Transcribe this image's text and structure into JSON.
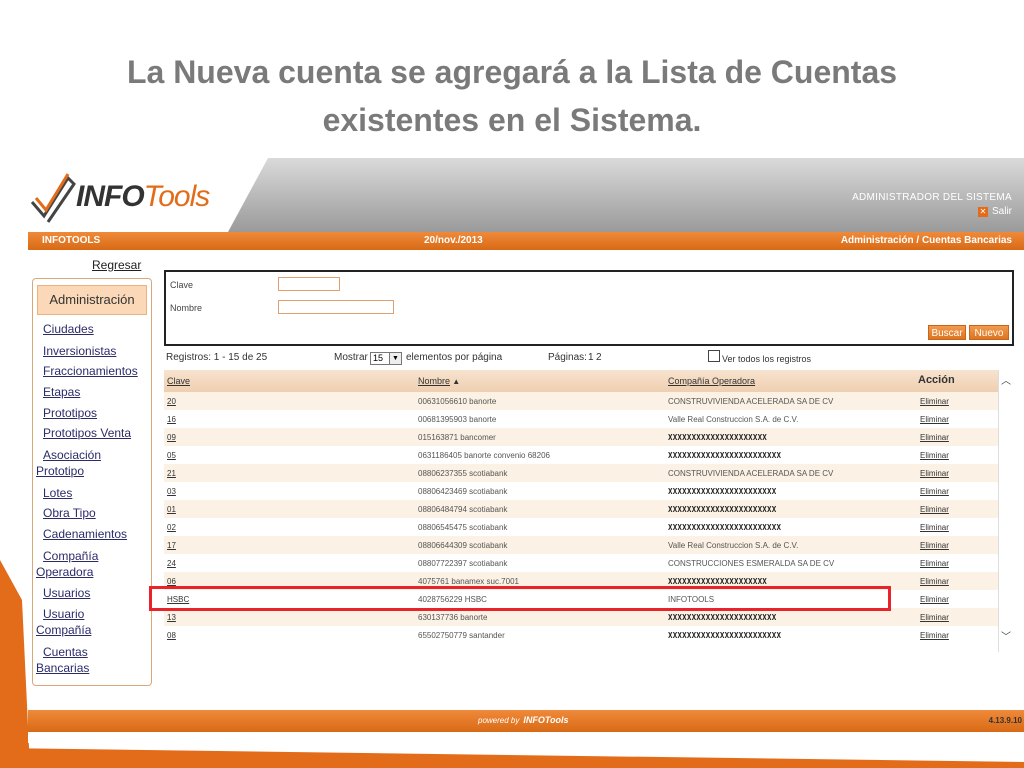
{
  "slide": {
    "title_line1": "La Nueva cuenta se agregará a la Lista de Cuentas",
    "title_line2": "existentes en el Sistema."
  },
  "header": {
    "logo_info": "INFO",
    "logo_tools": "Tools",
    "role": "ADMINISTRADOR DEL SISTEMA",
    "logout": "Salir"
  },
  "bar": {
    "company": "INFOTOOLS",
    "date": "20/nov./2013",
    "breadcrumb": "Administración / Cuentas Bancarias"
  },
  "sidebar": {
    "back": "Regresar",
    "heading": "Administración",
    "items": [
      "Ciudades",
      "Inversionistas",
      "Fraccionamientos",
      "Etapas",
      "Prototipos",
      "Prototipos Venta",
      "Asociación",
      "Prototipo",
      "Lotes",
      "Obra Tipo",
      "Cadenamientos",
      "Compañía",
      "Operadora",
      "Usuarios",
      "Usuario",
      "Compañía",
      "Cuentas",
      "Bancarias"
    ]
  },
  "search": {
    "clave_label": "Clave",
    "nombre_label": "Nombre",
    "clave_value": "",
    "nombre_value": "",
    "buscar": "Buscar",
    "nuevo": "Nuevo"
  },
  "pager": {
    "registros": "Registros: 1 - 15 de 25",
    "mostrar": "Mostrar",
    "per_page": "15",
    "elementos": "elementos por página",
    "paginas": "Páginas:",
    "page1": "1",
    "page2": "2",
    "ver_todos": "Ver todos los registros"
  },
  "table": {
    "columns": {
      "clave": "Clave",
      "nombre": "Nombre",
      "compania": "Compañía Operadora",
      "accion": "Acción"
    },
    "rows": [
      {
        "clave": "20",
        "nombre": "00631056610 banorte",
        "compania": "CONSTRUVIVIENDA ACELERADA SA DE CV",
        "accion": "Eliminar",
        "redacted": false
      },
      {
        "clave": "16",
        "nombre": "00681395903 banorte",
        "compania": "Valle Real Construccion S.A. de C.V.",
        "accion": "Eliminar",
        "redacted": false
      },
      {
        "clave": "09",
        "nombre": "015163871 bancomer",
        "compania": "XXXXXXXXXXXXXXXXXXXXX",
        "accion": "Eliminar",
        "redacted": true
      },
      {
        "clave": "05",
        "nombre": "0631186405 banorte convenio 68206",
        "compania": "XXXXXXXXXXXXXXXXXXXXXXXX",
        "accion": "Eliminar",
        "redacted": true
      },
      {
        "clave": "21",
        "nombre": "08806237355 scotiabank",
        "compania": "CONSTRUVIVIENDA ACELERADA SA DE CV",
        "accion": "Eliminar",
        "redacted": false
      },
      {
        "clave": "03",
        "nombre": "08806423469 scotiabank",
        "compania": "XXXXXXXXXXXXXXXXXXXXXXX",
        "accion": "Eliminar",
        "redacted": true
      },
      {
        "clave": "01",
        "nombre": "08806484794 scotiabank",
        "compania": "XXXXXXXXXXXXXXXXXXXXXXX",
        "accion": "Eliminar",
        "redacted": true
      },
      {
        "clave": "02",
        "nombre": "08806545475 scotiabank",
        "compania": "XXXXXXXXXXXXXXXXXXXXXXXX",
        "accion": "Eliminar",
        "redacted": true
      },
      {
        "clave": "17",
        "nombre": "08806644309 scotiabank",
        "compania": "Valle Real Construccion S.A. de C.V.",
        "accion": "Eliminar",
        "redacted": false
      },
      {
        "clave": "24",
        "nombre": "08807722397 scotiabank",
        "compania": "CONSTRUCCIONES ESMERALDA SA DE CV",
        "accion": "Eliminar",
        "redacted": false
      },
      {
        "clave": "06",
        "nombre": "4075761 banamex suc.7001",
        "compania": "XXXXXXXXXXXXXXXXXXXXX",
        "accion": "Eliminar",
        "redacted": true
      },
      {
        "clave": "HSBC",
        "nombre": "4028756229 HSBC",
        "compania": "INFOTOOLS",
        "accion": "Eliminar",
        "redacted": false
      },
      {
        "clave": "13",
        "nombre": "630137736 banorte",
        "compania": "XXXXXXXXXXXXXXXXXXXXXXX",
        "accion": "Eliminar",
        "redacted": true
      },
      {
        "clave": "08",
        "nombre": "65502750779 santander",
        "compania": "XXXXXXXXXXXXXXXXXXXXXXXX",
        "accion": "Eliminar",
        "redacted": true
      }
    ]
  },
  "footer": {
    "powered_by": "powered by",
    "brand": "INFOTools",
    "version": "4.13.9.10"
  },
  "colors": {
    "accent": "#e36c1a",
    "highlight": "#e8232a"
  }
}
